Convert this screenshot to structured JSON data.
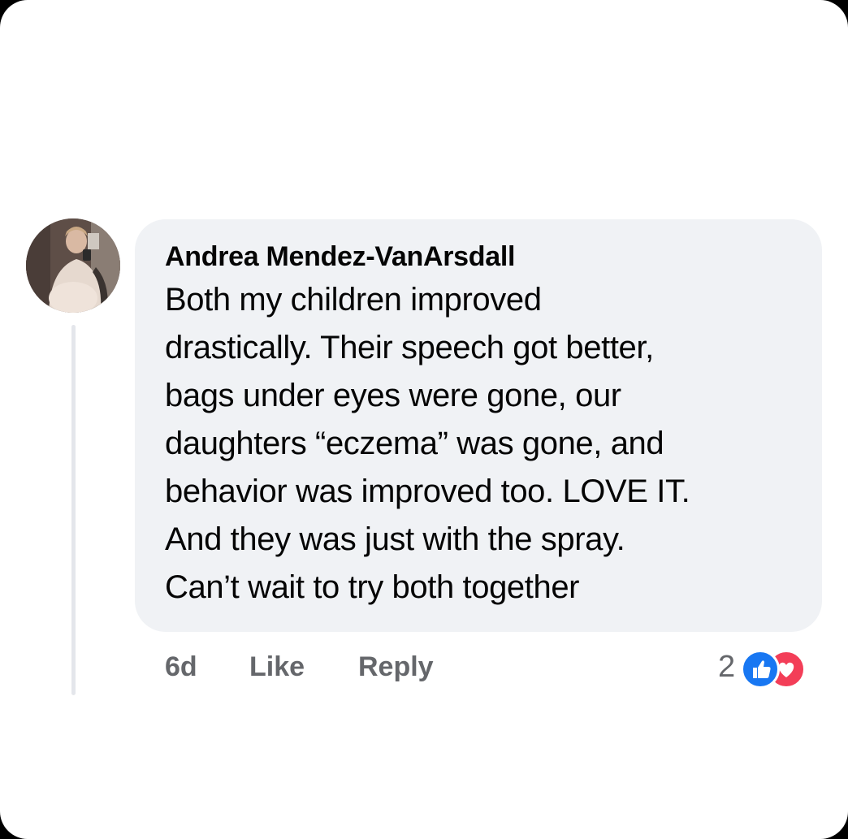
{
  "comment": {
    "author": "Andrea Mendez-VanArsdall",
    "body_lines": [
      "Both my children improved",
      "drastically. Their speech got better,",
      "bags under eyes were gone, our",
      "daughters “eczema” was gone, and",
      "behavior was improved too. LOVE IT.",
      "And they was just with the spray.",
      "Can’t wait to try both together"
    ],
    "avatar_icon": "profile-photo"
  },
  "actions": {
    "timestamp": "6d",
    "like_label": "Like",
    "reply_label": "Reply"
  },
  "reactions": {
    "count": "2",
    "icons": [
      "like-icon",
      "love-icon"
    ],
    "like_color": "#1877f2",
    "love_color": "#f33e58"
  },
  "colors": {
    "bubble": "#f0f2f5",
    "text": "#050505",
    "secondary_text": "#65676b"
  }
}
